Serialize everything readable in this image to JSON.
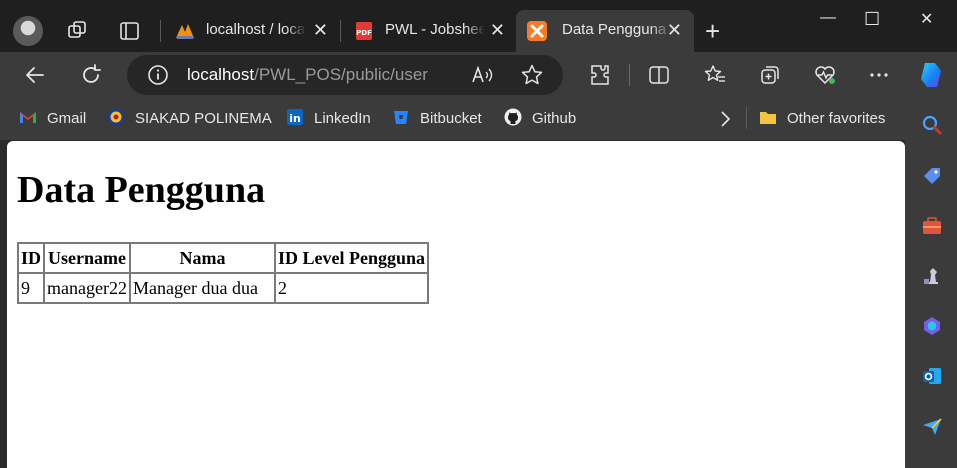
{
  "browser": {
    "tabs": [
      {
        "label": "localhost / localhost",
        "favicon": "phpmyadmin-icon",
        "active": false
      },
      {
        "label": "PWL - Jobsheet",
        "favicon": "pdf-icon",
        "active": false
      },
      {
        "label": "Data Pengguna",
        "favicon": "xampp-icon",
        "active": true
      }
    ],
    "tab_close_glyph": "✕",
    "new_tab_glyph": "+",
    "window_controls": {
      "minimize": "—",
      "maximize": "☐",
      "close": "✕"
    },
    "address": {
      "host": "localhost",
      "path": "/PWL_POS/public/user"
    },
    "favorites": [
      {
        "label": "Gmail",
        "icon": "gmail-icon"
      },
      {
        "label": "SIAKAD POLINEMA",
        "icon": "polinema-icon"
      },
      {
        "label": "LinkedIn",
        "icon": "linkedin-icon"
      },
      {
        "label": "Bitbucket",
        "icon": "bitbucket-icon"
      },
      {
        "label": "Github",
        "icon": "github-icon"
      }
    ],
    "other_favorites": "Other favorites",
    "colors": {
      "frame": "#1f1f1f",
      "toolbar": "#3b3b3b",
      "page": "#ffffff"
    }
  },
  "page": {
    "title": "Data Pengguna",
    "table": {
      "headers": [
        "ID",
        "Username",
        "Nama",
        "ID Level Pengguna"
      ],
      "rows": [
        [
          "9",
          "manager22",
          "Manager dua dua",
          "2"
        ]
      ]
    }
  }
}
